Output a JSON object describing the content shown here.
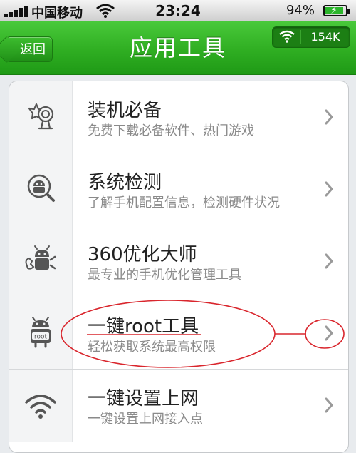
{
  "status_bar": {
    "carrier": "中国移动",
    "time": "23:24",
    "battery_percent": "94%",
    "battery_level": 0.94,
    "icons": [
      "signal-bars-icon",
      "wifi-icon",
      "battery-charging-icon"
    ]
  },
  "nav": {
    "back_label": "返回",
    "title": "应用工具",
    "speed_value": "154K",
    "speed_icon": "wifi-icon"
  },
  "colors": {
    "nav_green": "#2fae22",
    "annotation_red": "#d9262d"
  },
  "items": [
    {
      "title": "装机必备",
      "subtitle": "免费下载必备软件、热门游戏",
      "icon": "star-camera-icon"
    },
    {
      "title": "系统检测",
      "subtitle": "了解手机配置信息，检测硬件状况",
      "icon": "android-magnifier-icon"
    },
    {
      "title": "360优化大师",
      "subtitle": "最专业的手机优化管理工具",
      "icon": "android-wrench-icon"
    },
    {
      "title": "一键root工具",
      "subtitle": "轻松获取系统最高权限",
      "icon": "android-root-icon"
    },
    {
      "title": "一键设置上网",
      "subtitle": "一键设置上网接入点",
      "icon": "wifi-setup-icon"
    }
  ]
}
